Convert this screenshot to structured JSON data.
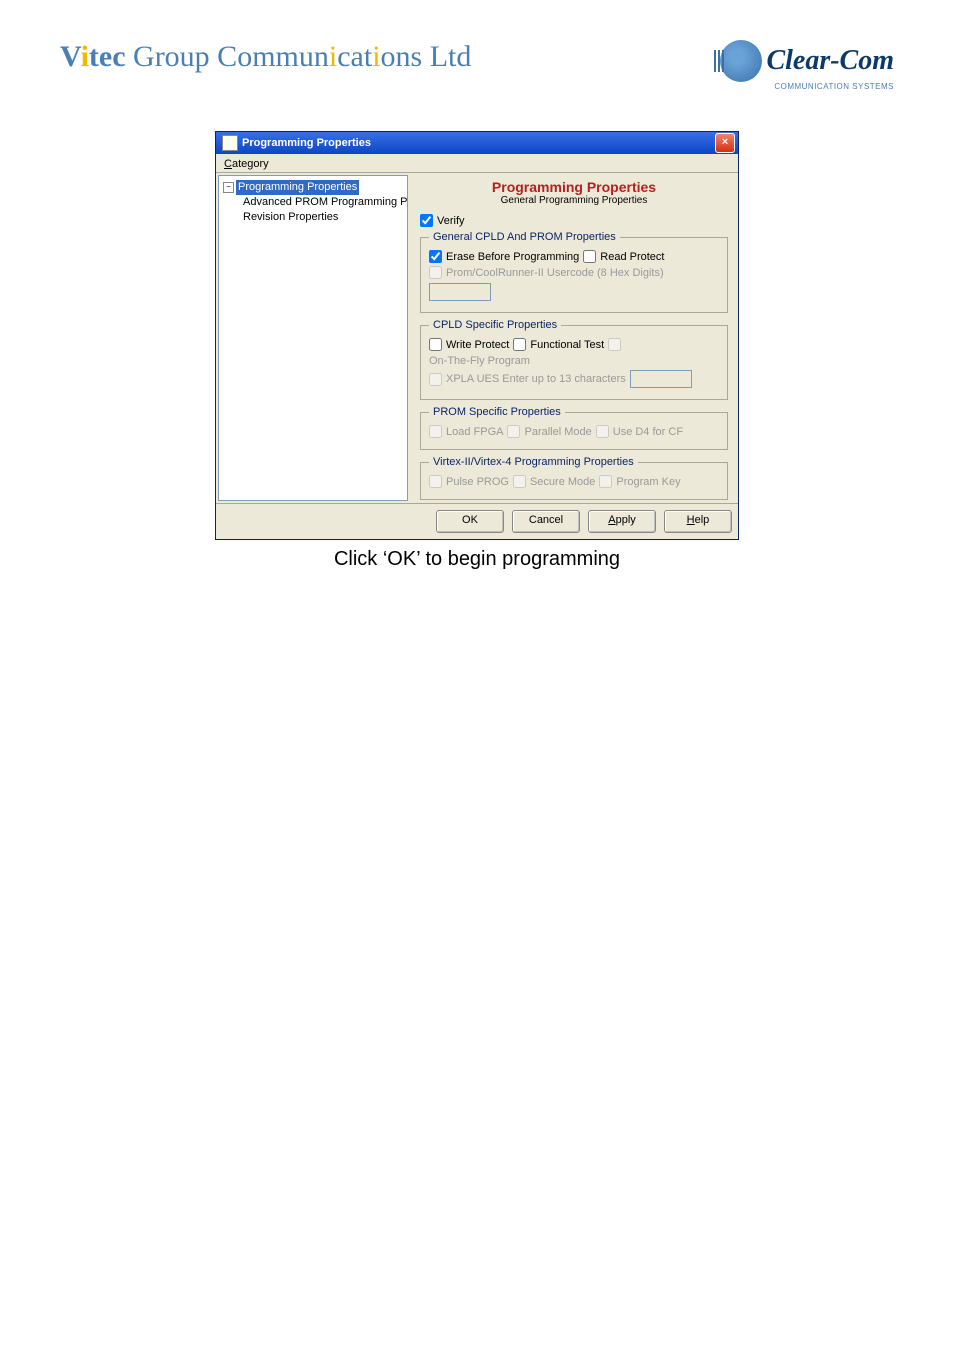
{
  "header": {
    "company_html": "Vitec Group Communications Ltd",
    "logo_text": "Clear-Com",
    "logo_sub": "COMMUNICATION SYSTEMS"
  },
  "dialog": {
    "title": "Programming Properties",
    "category_label": "Category",
    "tree": {
      "root": "Programming Properties",
      "children": [
        "Advanced PROM Programming Properties",
        "Revision Properties"
      ]
    },
    "panel": {
      "title": "Programming Properties",
      "subtitle": "General Programming Properties",
      "verify": "Verify",
      "group1": {
        "legend": "General CPLD And PROM Properties",
        "erase": "Erase Before Programming",
        "read": "Read Protect",
        "prom": "Prom/CoolRunner-II Usercode (8 Hex Digits)"
      },
      "group2": {
        "legend": "CPLD Specific Properties",
        "write": "Write Protect",
        "func": "Functional Test",
        "ontf": "On-The-Fly Program",
        "xpla": "XPLA UES Enter up to 13 characters"
      },
      "group3": {
        "legend": "PROM Specific Properties",
        "load": "Load FPGA",
        "par": "Parallel Mode",
        "d4": "Use D4 for CF"
      },
      "group4": {
        "legend": "Virtex-II/Virtex-4 Programming Properties",
        "pulse": "Pulse PROG",
        "secure": "Secure Mode",
        "prog": "Program Key"
      }
    },
    "buttons": {
      "ok": "OK",
      "cancel": "Cancel",
      "apply": "Apply",
      "help": "Help"
    }
  },
  "caption": "Click ‘OK’ to begin programming"
}
